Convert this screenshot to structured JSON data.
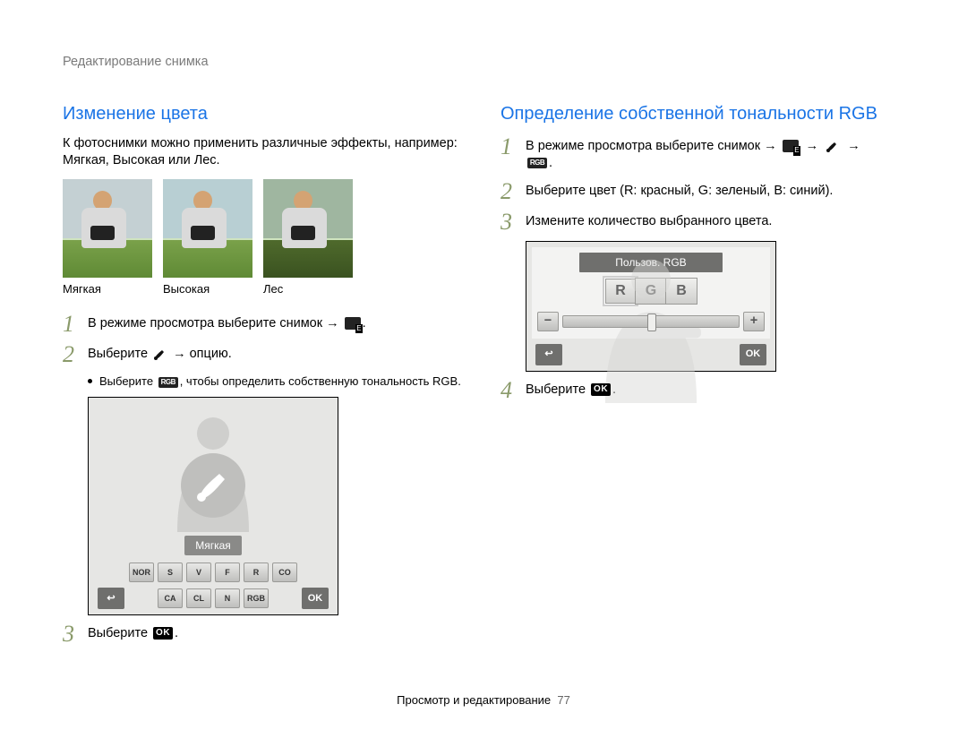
{
  "header": {
    "title": "Редактирование снимка"
  },
  "footer": {
    "section": "Просмотр и редактирование",
    "page": "77"
  },
  "left": {
    "title": "Изменение цвета",
    "intro": "К фотоснимки можно применить различные эффекты, например: Мягкая, Высокая или Лес.",
    "thumbLabels": {
      "a": "Мягкая",
      "b": "Высокая",
      "c": "Лес"
    },
    "steps": {
      "s1_pre": "В режиме просмотра выберите снимок →",
      "s2_pre": "Выберите",
      "s2_post": "→ опцию.",
      "bullet_pre": "Выберите",
      "bullet_post": ", чтобы определить собственную тональность RGB.",
      "s3_pre": "Выберите"
    },
    "screen": {
      "chip": "Мягкая"
    },
    "icon_text": {
      "rgb": "RGB",
      "ok": "OK"
    },
    "mini_icons": [
      "NOR",
      "S",
      "V",
      "F",
      "R",
      "CO",
      "CA",
      "CL",
      "N",
      "RGB"
    ]
  },
  "right": {
    "title": "Определение собственной тональности RGB",
    "steps": {
      "s1_pre": "В режиме просмотра выберите снимок →",
      "s2": "Выберите цвет (R: красный, G: зеленый, B: синий).",
      "s3": "Измените количество выбранного цвета.",
      "s4_pre": "Выберите"
    },
    "screen": {
      "header": "Пользов. RGB",
      "channels": {
        "r": "R",
        "g": "G",
        "b": "B"
      },
      "minus": "−",
      "plus": "+"
    }
  }
}
